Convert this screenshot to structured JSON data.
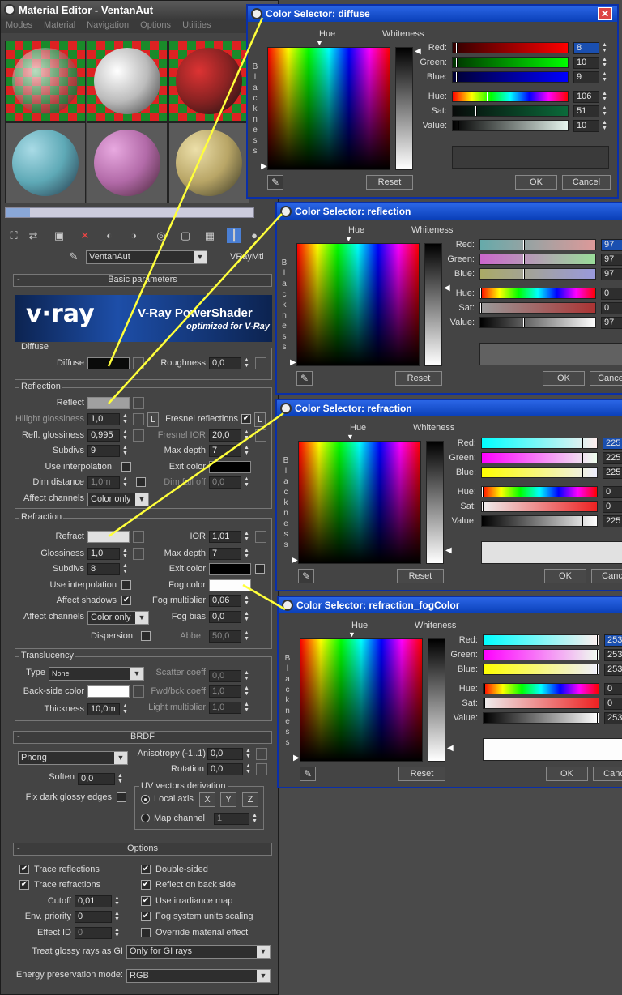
{
  "material_editor": {
    "title": "Material Editor - VentanAut",
    "menu": [
      "Modes",
      "Material",
      "Navigation",
      "Options",
      "Utilities"
    ],
    "material_name": "VentanAut",
    "material_type": "VRayMtl",
    "basic": {
      "rollout": "Basic parameters",
      "banner_title": "V-Ray PowerShader",
      "banner_sub": "optimized for V-Ray",
      "banner_logo": "v·ray",
      "diffuse_group": "Diffuse",
      "diffuse_label": "Diffuse",
      "roughness_label": "Roughness",
      "roughness": "0,0",
      "reflection_group": "Reflection",
      "reflect_label": "Reflect",
      "hilight_label": "Hilight glossiness",
      "hilight": "1,0",
      "l1": "L",
      "fresnel_label": "Fresnel reflections",
      "l2": "L",
      "refl_gloss_label": "Refl. glossiness",
      "refl_gloss": "0,995",
      "fresnel_ior_label": "Fresnel IOR",
      "fresnel_ior": "20,0",
      "subdivs_label": "Subdivs",
      "subdivs": "9",
      "maxdepth_label": "Max depth",
      "maxdepth": "7",
      "use_interp_label": "Use interpolation",
      "exit_color_label": "Exit color",
      "dim_dist_label": "Dim distance",
      "dim_dist": "1,0m",
      "dim_falloff_label": "Dim fall off",
      "dim_falloff": "0,0",
      "affect_label": "Affect channels",
      "affect_value": "Color only",
      "refraction_group": "Refraction",
      "refract_label": "Refract",
      "ior_label": "IOR",
      "ior": "1,01",
      "gloss_label": "Glossiness",
      "gloss": "1,0",
      "r_maxdepth_label": "Max depth",
      "r_maxdepth": "7",
      "r_subdivs_label": "Subdivs",
      "r_subdivs": "8",
      "r_exit_label": "Exit color",
      "r_use_interp_label": "Use interpolation",
      "fog_color_label": "Fog color",
      "affect_shadows_label": "Affect shadows",
      "fog_mult_label": "Fog multiplier",
      "fog_mult": "0,06",
      "r_affect_label": "Affect channels",
      "r_affect_value": "Color only",
      "fog_bias_label": "Fog bias",
      "fog_bias": "0,0",
      "dispersion_label": "Dispersion",
      "abbe_label": "Abbe",
      "abbe": "50,0",
      "trans_group": "Translucency",
      "type_label": "Type",
      "type_value": "None",
      "scatter_label": "Scatter coeff",
      "scatter": "0,0",
      "backside_label": "Back-side color",
      "fwdbck_label": "Fwd/bck coeff",
      "fwdbck": "1,0",
      "thickness_label": "Thickness",
      "thickness": "10,0m",
      "light_mult_label": "Light multiplier",
      "light_mult": "1,0"
    },
    "brdf": {
      "rollout": "BRDF",
      "type": "Phong",
      "aniso_label": "Anisotropy (-1..1)",
      "aniso": "0,0",
      "rotation_label": "Rotation",
      "rotation": "0,0",
      "soften_label": "Soften",
      "soften": "0,0",
      "fix_label": "Fix dark glossy edges",
      "uv_group": "UV vectors derivation",
      "local_axis": "Local axis",
      "x": "X",
      "y": "Y",
      "z": "Z",
      "map_channel": "Map channel",
      "map_channel_value": "1"
    },
    "options": {
      "rollout": "Options",
      "trace_refl": "Trace reflections",
      "trace_refr": "Trace refractions",
      "cutoff_label": "Cutoff",
      "cutoff": "0,01",
      "env_label": "Env. priority",
      "env": "0",
      "effect_label": "Effect ID",
      "effect": "0",
      "double_sided": "Double-sided",
      "reflect_back": "Reflect on back side",
      "use_irr": "Use irradiance map",
      "fog_units": "Fog system units scaling",
      "override": "Override material effect",
      "glossy_gi_label": "Treat glossy rays as GI",
      "glossy_gi_value": "Only for GI rays",
      "energy_label": "Energy preservation mode:",
      "energy_value": "RGB"
    }
  },
  "dialogs": [
    {
      "title": "Color Selector: diffuse",
      "hue": "Hue",
      "whiteness": "Whiteness",
      "blackness": "Blackness",
      "red": "Red:",
      "green": "Green:",
      "blue": "Blue:",
      "hue_lbl": "Hue:",
      "sat": "Sat:",
      "value": "Value:",
      "red_v": "8",
      "green_v": "10",
      "blue_v": "9",
      "hue_v": "106",
      "sat_v": "51",
      "value_v": "10",
      "reset": "Reset",
      "ok": "OK",
      "cancel": "Cancel",
      "color": "#080a09"
    },
    {
      "title": "Color Selector: reflection",
      "hue": "Hue",
      "whiteness": "Whiteness",
      "blackness": "Blackness",
      "red": "Red:",
      "green": "Green:",
      "blue": "Blue:",
      "hue_lbl": "Hue:",
      "sat": "Sat:",
      "value": "Value:",
      "red_v": "97",
      "green_v": "97",
      "blue_v": "97",
      "hue_v": "0",
      "sat_v": "0",
      "value_v": "97",
      "reset": "Reset",
      "ok": "OK",
      "cancel": "Cance",
      "color": "#616161"
    },
    {
      "title": "Color Selector: refraction",
      "hue": "Hue",
      "whiteness": "Whiteness",
      "blackness": "Blackness",
      "red": "Red:",
      "green": "Green:",
      "blue": "Blue:",
      "hue_lbl": "Hue:",
      "sat": "Sat:",
      "value": "Value:",
      "red_v": "225",
      "green_v": "225",
      "blue_v": "225",
      "hue_v": "0",
      "sat_v": "0",
      "value_v": "225",
      "reset": "Reset",
      "ok": "OK",
      "cancel": "Canc",
      "color": "#e1e1e1"
    },
    {
      "title": "Color Selector: refraction_fogColor",
      "hue": "Hue",
      "whiteness": "Whiteness",
      "blackness": "Blackness",
      "red": "Red:",
      "green": "Green:",
      "blue": "Blue:",
      "hue_lbl": "Hue:",
      "sat": "Sat:",
      "value": "Value:",
      "red_v": "253",
      "green_v": "253",
      "blue_v": "253",
      "hue_v": "0",
      "sat_v": "0",
      "value_v": "253",
      "reset": "Reset",
      "ok": "OK",
      "cancel": "Canc",
      "color": "#fdfdfd"
    }
  ]
}
